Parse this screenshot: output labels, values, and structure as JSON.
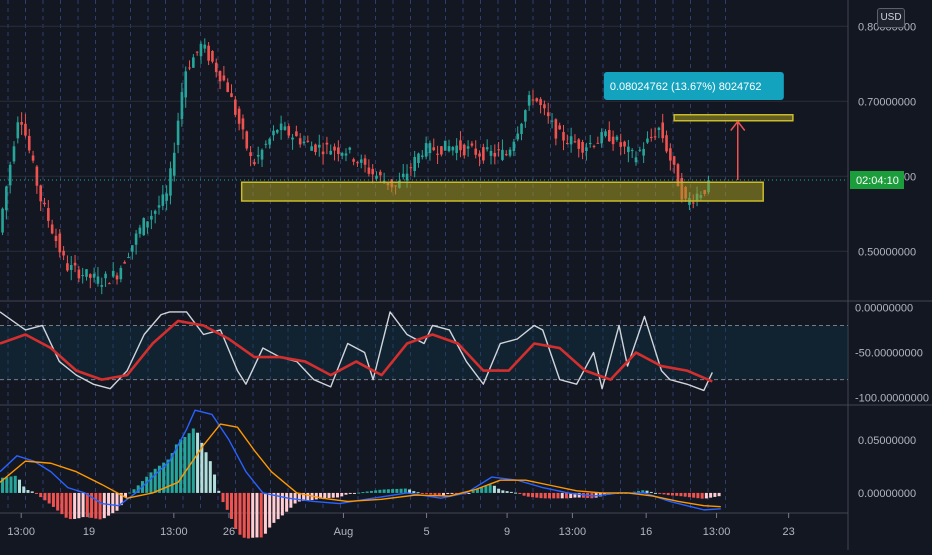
{
  "currency_badge": "USD",
  "countdown_label": "02:04:10",
  "measure_label": "0.08024762 (13.67%) 8024762",
  "colors": {
    "background": "#131722",
    "grid": "#2a2e39",
    "up_candle": "#26a69a",
    "down_candle": "#ef5350",
    "stoch_k": "#d1d4dc",
    "stoch_d": "#d32f2f",
    "macd_line": "#2962ff",
    "signal_line": "#ff9800",
    "support_zone": "#a59a1f",
    "measure_box": "#13a3bf",
    "arrow": "#ef5350",
    "price_tag": "#1a9d3a"
  },
  "chart_data": [
    {
      "type": "candlestick",
      "yticks": [
        "0.80000000",
        "0.70000000",
        "0.60000000",
        "0.50000000"
      ],
      "ylim": [
        0.435,
        0.835
      ],
      "xticks": [
        "13:00",
        "19",
        "13:00",
        "26",
        "Aug",
        "5",
        "9",
        "13:00",
        "16",
        "13:00",
        "23"
      ],
      "x_range": [
        0,
        100
      ],
      "segments": [
        {
          "x": 0,
          "y": 0.52
        },
        {
          "x": 2.5,
          "y": 0.69
        },
        {
          "x": 5,
          "y": 0.57
        },
        {
          "x": 8,
          "y": 0.48
        },
        {
          "x": 12,
          "y": 0.46
        },
        {
          "x": 14,
          "y": 0.47
        },
        {
          "x": 17,
          "y": 0.535
        },
        {
          "x": 20,
          "y": 0.575
        },
        {
          "x": 22,
          "y": 0.74
        },
        {
          "x": 24,
          "y": 0.775
        },
        {
          "x": 27,
          "y": 0.72
        },
        {
          "x": 30,
          "y": 0.615
        },
        {
          "x": 33,
          "y": 0.665
        },
        {
          "x": 37,
          "y": 0.64
        },
        {
          "x": 41,
          "y": 0.635
        },
        {
          "x": 44,
          "y": 0.605
        },
        {
          "x": 47,
          "y": 0.585
        },
        {
          "x": 50,
          "y": 0.635
        },
        {
          "x": 54,
          "y": 0.64
        },
        {
          "x": 57,
          "y": 0.63
        },
        {
          "x": 60,
          "y": 0.63
        },
        {
          "x": 63,
          "y": 0.71
        },
        {
          "x": 66,
          "y": 0.655
        },
        {
          "x": 69,
          "y": 0.64
        },
        {
          "x": 72,
          "y": 0.655
        },
        {
          "x": 75,
          "y": 0.625
        },
        {
          "x": 78,
          "y": 0.665
        },
        {
          "x": 81,
          "y": 0.565
        },
        {
          "x": 84,
          "y": 0.588
        }
      ],
      "support_zone": {
        "x_start": 28.5,
        "x_end": 90,
        "y_low": 0.567,
        "y_high": 0.592
      },
      "target_zone": {
        "x_start": 79.5,
        "x_end": 93.5,
        "y_low": 0.674,
        "y_high": 0.682
      },
      "arrow": {
        "x": 87,
        "y_from": 0.595,
        "y_to": 0.673
      },
      "current_price": 0.595,
      "annotations": [
        {
          "text": "0.08024762 (13.67%) 8024762",
          "x": 83,
          "y": 0.715
        }
      ]
    },
    {
      "type": "line",
      "name": "stochastic",
      "yticks": [
        "0.00000000",
        "-50.00000000",
        "-100.00000000"
      ],
      "ylim": [
        -107,
        6
      ],
      "band": [
        -20,
        -80
      ],
      "series": [
        {
          "role": "k",
          "x": [
            0,
            3,
            5,
            7,
            9,
            11,
            13,
            15,
            17,
            19,
            20,
            22,
            24,
            26,
            28,
            29,
            31,
            33,
            35,
            37,
            39,
            41,
            43,
            44,
            46,
            48,
            50,
            51,
            53,
            55,
            57,
            59,
            61,
            63,
            64,
            66,
            68,
            70,
            71,
            73,
            74,
            76,
            78,
            79,
            81,
            83,
            84
          ],
          "values": [
            -5,
            -25,
            -20,
            -60,
            -75,
            -85,
            -90,
            -70,
            -30,
            -8,
            -5,
            -5,
            -30,
            -25,
            -70,
            -85,
            -45,
            -55,
            -60,
            -80,
            -88,
            -40,
            -50,
            -80,
            -5,
            -30,
            -40,
            -20,
            -25,
            -60,
            -85,
            -40,
            -35,
            -20,
            -25,
            -80,
            -85,
            -50,
            -90,
            -20,
            -65,
            -10,
            -70,
            -80,
            -85,
            -92,
            -72
          ]
        },
        {
          "role": "d",
          "x": [
            0,
            3,
            6,
            9,
            12,
            15,
            18,
            21,
            24,
            27,
            30,
            33,
            36,
            39,
            42,
            45,
            48,
            51,
            54,
            57,
            60,
            63,
            66,
            69,
            72,
            75,
            78,
            81,
            84
          ],
          "values": [
            -40,
            -30,
            -45,
            -70,
            -80,
            -75,
            -40,
            -15,
            -20,
            -35,
            -55,
            -55,
            -60,
            -75,
            -60,
            -75,
            -40,
            -30,
            -40,
            -70,
            -70,
            -40,
            -45,
            -70,
            -80,
            -50,
            -65,
            -70,
            -82
          ]
        }
      ]
    },
    {
      "type": "bar",
      "name": "macd",
      "yticks": [
        "0.05000000",
        "0.00000000"
      ],
      "ylim": [
        -0.018,
        0.082
      ],
      "series": [
        {
          "role": "macd",
          "x": [
            0,
            2,
            4,
            6,
            8,
            10,
            12,
            14,
            16,
            18,
            20,
            22,
            23,
            25,
            27,
            29,
            31,
            34,
            37,
            40,
            44,
            48,
            52,
            55,
            58,
            61,
            64,
            67,
            70,
            73,
            76,
            79,
            81,
            83,
            85
          ],
          "values": [
            0.02,
            0.035,
            0.03,
            0.02,
            0.005,
            0,
            -0.01,
            -0.012,
            0.0,
            0.015,
            0.03,
            0.06,
            0.078,
            0.074,
            0.05,
            0.02,
            0.0,
            -0.005,
            -0.008,
            -0.01,
            -0.005,
            0.0,
            -0.005,
            0.0,
            0.015,
            0.012,
            0.005,
            0.0,
            -0.003,
            0.0,
            0.0,
            -0.008,
            -0.012,
            -0.016,
            -0.015
          ]
        },
        {
          "role": "signal",
          "x": [
            0,
            3,
            6,
            9,
            12,
            15,
            18,
            21,
            24,
            26,
            28,
            30,
            32,
            35,
            38,
            41,
            45,
            49,
            53,
            56,
            59,
            62,
            65,
            68,
            71,
            74,
            77,
            80,
            83,
            85
          ],
          "values": [
            0.01,
            0.03,
            0.028,
            0.02,
            0.008,
            -0.005,
            0.0,
            0.01,
            0.045,
            0.065,
            0.062,
            0.04,
            0.02,
            0.0,
            -0.005,
            -0.008,
            -0.006,
            -0.002,
            -0.003,
            0.003,
            0.012,
            0.012,
            0.007,
            0.002,
            0.0,
            0.0,
            -0.003,
            -0.008,
            -0.012,
            -0.013
          ]
        }
      ]
    }
  ]
}
